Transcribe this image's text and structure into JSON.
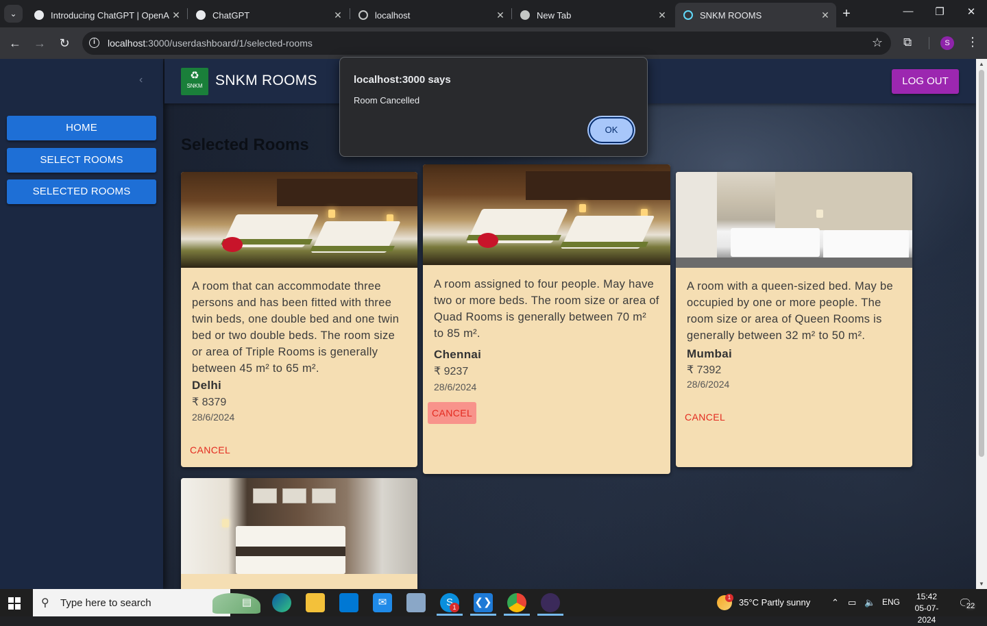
{
  "browser": {
    "tabs": [
      {
        "title": "Introducing ChatGPT | OpenAI",
        "favicon": "openai-icon",
        "active": false
      },
      {
        "title": "ChatGPT",
        "favicon": "openai-icon",
        "active": false
      },
      {
        "title": "localhost",
        "favicon": "globe-icon",
        "active": false
      },
      {
        "title": "New Tab",
        "favicon": "chrome-icon",
        "active": false
      },
      {
        "title": "SNKM ROOMS",
        "favicon": "react-icon",
        "active": true
      }
    ],
    "address": {
      "host": "localhost",
      "rest": ":3000/userdashboard/1/selected-rooms"
    },
    "profile_initial": "S"
  },
  "sidebar": {
    "items": [
      {
        "label": "HOME"
      },
      {
        "label": "SELECT ROOMS"
      },
      {
        "label": "SELECTED ROOMS"
      }
    ]
  },
  "appbar": {
    "logo_text": "SNKM",
    "brand": "SNKM ROOMS",
    "logout_label": "LOG OUT"
  },
  "main": {
    "title": "Selected Rooms",
    "rooms": [
      {
        "description": "A room that can accommodate three persons and has been fitted with three twin beds, one double bed and one twin bed or two double beds. The room size or area of Triple Rooms is generally between 45 m² to 65 m².",
        "city": "Delhi",
        "price": "₹ 8379",
        "date": "28/6/2024",
        "cancel_label": "CANCEL"
      },
      {
        "description": "A room assigned to four people. May have two or more beds. The room size or area of Quad Rooms is generally between 70 m² to 85 m².",
        "city": "Chennai",
        "price": "₹ 9237",
        "date": "28/6/2024",
        "cancel_label": "CANCEL"
      },
      {
        "description": "A room with a queen-sized bed. May be occupied by one or more people. The room size or area of Queen Rooms is generally between 32 m² to 50 m².",
        "city": "Mumbai",
        "price": "₹ 7392",
        "date": "28/6/2024",
        "cancel_label": "CANCEL"
      }
    ]
  },
  "dialog": {
    "title": "localhost:3000 says",
    "message": "Room Cancelled",
    "ok_label": "OK"
  },
  "taskbar": {
    "search_placeholder": "Type here to search",
    "weather": "35°C  Partly sunny",
    "language": "ENG",
    "time": "15:42",
    "date": "05-07-2024",
    "notification_count": "22",
    "skype_badge": "1",
    "weather_badge": "1"
  },
  "colors": {
    "sidebar_button": "#1e6fd6",
    "logout_button": "#9c27b0",
    "card_background": "#f5deb3",
    "cancel_text": "#e32a1f",
    "dialog_ok": "#a8c7fa"
  }
}
